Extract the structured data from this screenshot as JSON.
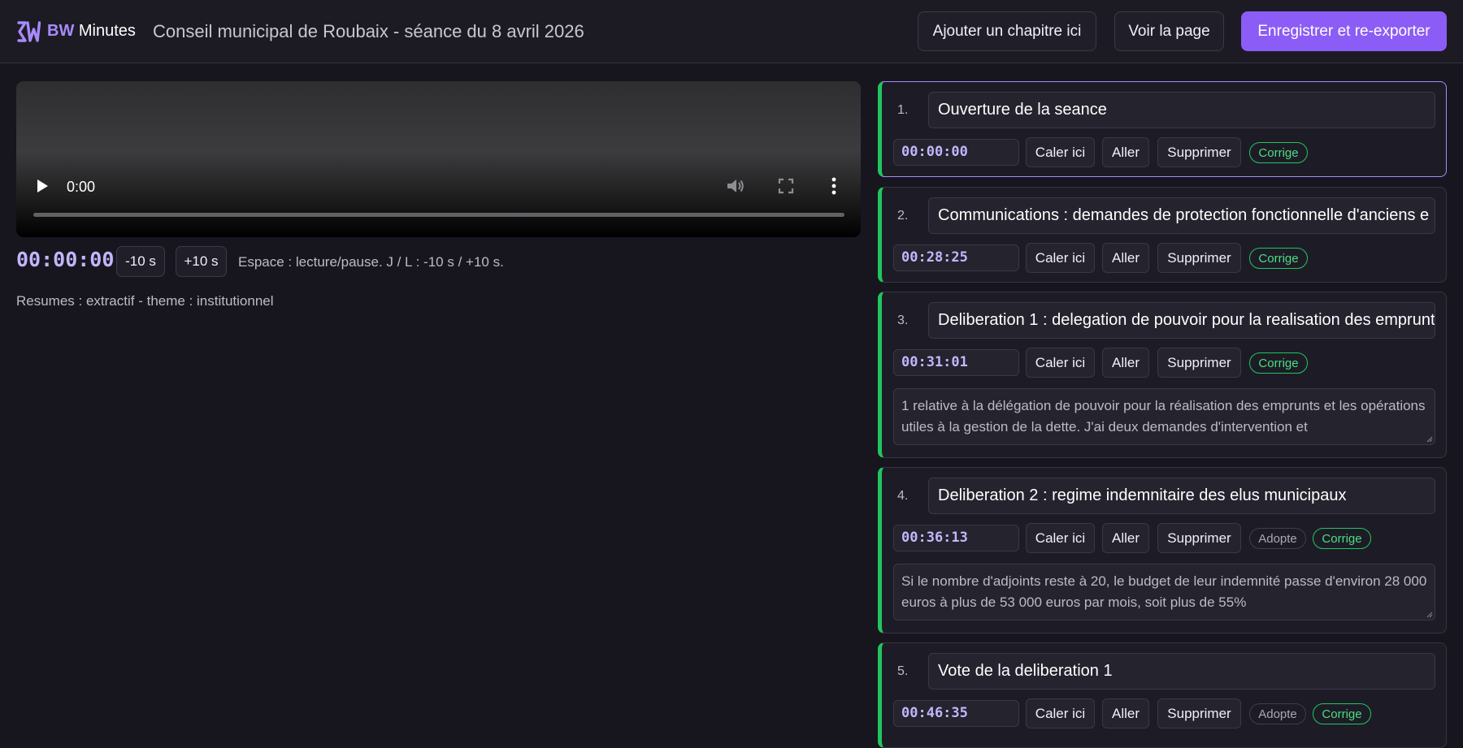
{
  "header": {
    "brand_strong": "BW",
    "brand_rest": " Minutes",
    "document_title": "Conseil municipal de Roubaix - séance du 8 avril 2026",
    "add_chapter_label": "Ajouter un chapitre ici",
    "view_page_label": "Voir la page",
    "save_export_label": "Enregistrer et re-exporter"
  },
  "player": {
    "time": "0:00",
    "clock": "00:00:00",
    "back_label": "-10 s",
    "forward_label": "+10 s",
    "shortcuts_hint": "Espace : lecture/pause. J / L : -10 s / +10 s.",
    "summary_mode": "Resumes : extractif - theme : institutionnel",
    "progress": 0
  },
  "chapter_actions": {
    "set_label": "Caler ici",
    "go_label": "Aller",
    "delete_label": "Supprimer"
  },
  "chapters": [
    {
      "number": "1.",
      "title": "Ouverture de la seance",
      "time": "00:00:00",
      "adopted": "",
      "corrected": "Corrige",
      "summary": ""
    },
    {
      "number": "2.",
      "title": "Communications : demandes de protection fonctionnelle d'anciens e",
      "time": "00:28:25",
      "adopted": "",
      "corrected": "Corrige",
      "summary": ""
    },
    {
      "number": "3.",
      "title": "Deliberation 1 : delegation de pouvoir pour la realisation des emprunt",
      "time": "00:31:01",
      "adopted": "",
      "corrected": "Corrige",
      "summary": "1 relative à la délégation de pouvoir pour la réalisation des emprunts et les opérations utiles à la gestion de la dette. J'ai deux demandes d'intervention et"
    },
    {
      "number": "4.",
      "title": "Deliberation 2 : regime indemnitaire des elus municipaux",
      "time": "00:36:13",
      "adopted": "Adopte",
      "corrected": "Corrige",
      "summary": "Si le nombre d'adjoints reste à 20, le budget de leur indemnité passe d'environ 28 000 euros à plus de 53 000 euros par mois, soit plus de 55%"
    },
    {
      "number": "5.",
      "title": "Vote de la deliberation 1",
      "time": "00:46:35",
      "adopted": "Adopte",
      "corrected": "Corrige",
      "summary": ""
    }
  ],
  "colors": {
    "accent": "#8b5cf6",
    "accent_light": "#a78bfa",
    "success": "#22c55e",
    "background": "#17161e"
  },
  "icons": [
    "logo-icon",
    "play-icon",
    "volume-icon",
    "fullscreen-icon",
    "more-options-icon"
  ]
}
